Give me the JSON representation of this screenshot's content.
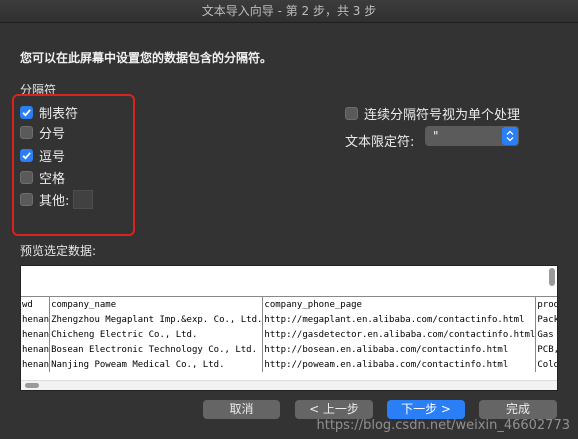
{
  "window": {
    "title": "文本导入向导 - 第 2 步，共 3 步"
  },
  "instruction": "您可以在此屏幕中设置您的数据包含的分隔符。",
  "delimiters": {
    "group_label": "分隔符",
    "items": [
      {
        "label": "制表符",
        "checked": true
      },
      {
        "label": "分号",
        "checked": false
      },
      {
        "label": "逗号",
        "checked": true
      },
      {
        "label": "空格",
        "checked": false
      },
      {
        "label": "其他:",
        "checked": false
      }
    ],
    "other_value": ""
  },
  "options": {
    "consecutive_label": "连续分隔符号视为单个处理",
    "consecutive_checked": false,
    "qualifier_label": "文本限定符:",
    "qualifier_value": "\""
  },
  "preview": {
    "label": "预览选定数据:",
    "columns": [
      "wd",
      "company_name",
      "company_phone_page",
      "prod"
    ],
    "rows": [
      [
        "henan",
        "Zhengzhou Megaplant Imp.&exp. Co., Ltd.",
        "http://megaplant.en.alibaba.com/contactinfo.html",
        "Pack"
      ],
      [
        "henan",
        " Chicheng Electric Co., Ltd.",
        "http://gasdetector.en.alibaba.com/contactinfo.html",
        "Gas"
      ],
      [
        "henan",
        " Bosean Electronic Technology Co., Ltd.",
        "http://bosean.en.alibaba.com/contactinfo.html",
        "PCB,"
      ],
      [
        "henan",
        "Nanjing Poweam Medical Co., Ltd.",
        "http://poweam.en.alibaba.com/contactinfo.html",
        "Cold"
      ]
    ]
  },
  "buttons": {
    "cancel": "取消",
    "back": "< 上一步",
    "next": "下一步 >",
    "finish": "完成"
  },
  "watermark": "https://blog.csdn.net/weixin_46602773",
  "colors": {
    "accent": "#2a7ef6",
    "highlight": "#d9241c"
  }
}
